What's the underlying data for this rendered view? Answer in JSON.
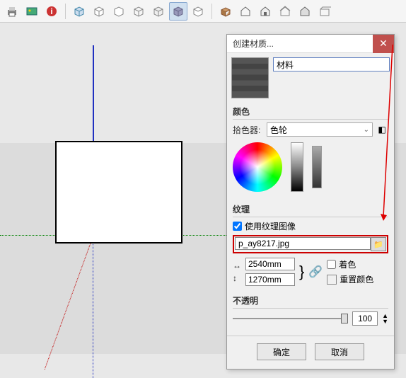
{
  "toolbar": {
    "icons": [
      "print",
      "scene",
      "help"
    ]
  },
  "dialog": {
    "title": "创建材质...",
    "name_value": "材料",
    "color": {
      "section_label": "颜色",
      "picker_label": "拾色器:",
      "picker_value": "色轮"
    },
    "texture": {
      "section_label": "纹理",
      "use_image_label": "使用纹理图像",
      "file_value": "p_ay8217.jpg",
      "width_value": "2540mm",
      "height_value": "1270mm",
      "colorize_label": "着色",
      "reset_color_label": "重置颜色"
    },
    "opacity": {
      "section_label": "不透明",
      "value": "100"
    },
    "ok_label": "确定",
    "cancel_label": "取消"
  }
}
